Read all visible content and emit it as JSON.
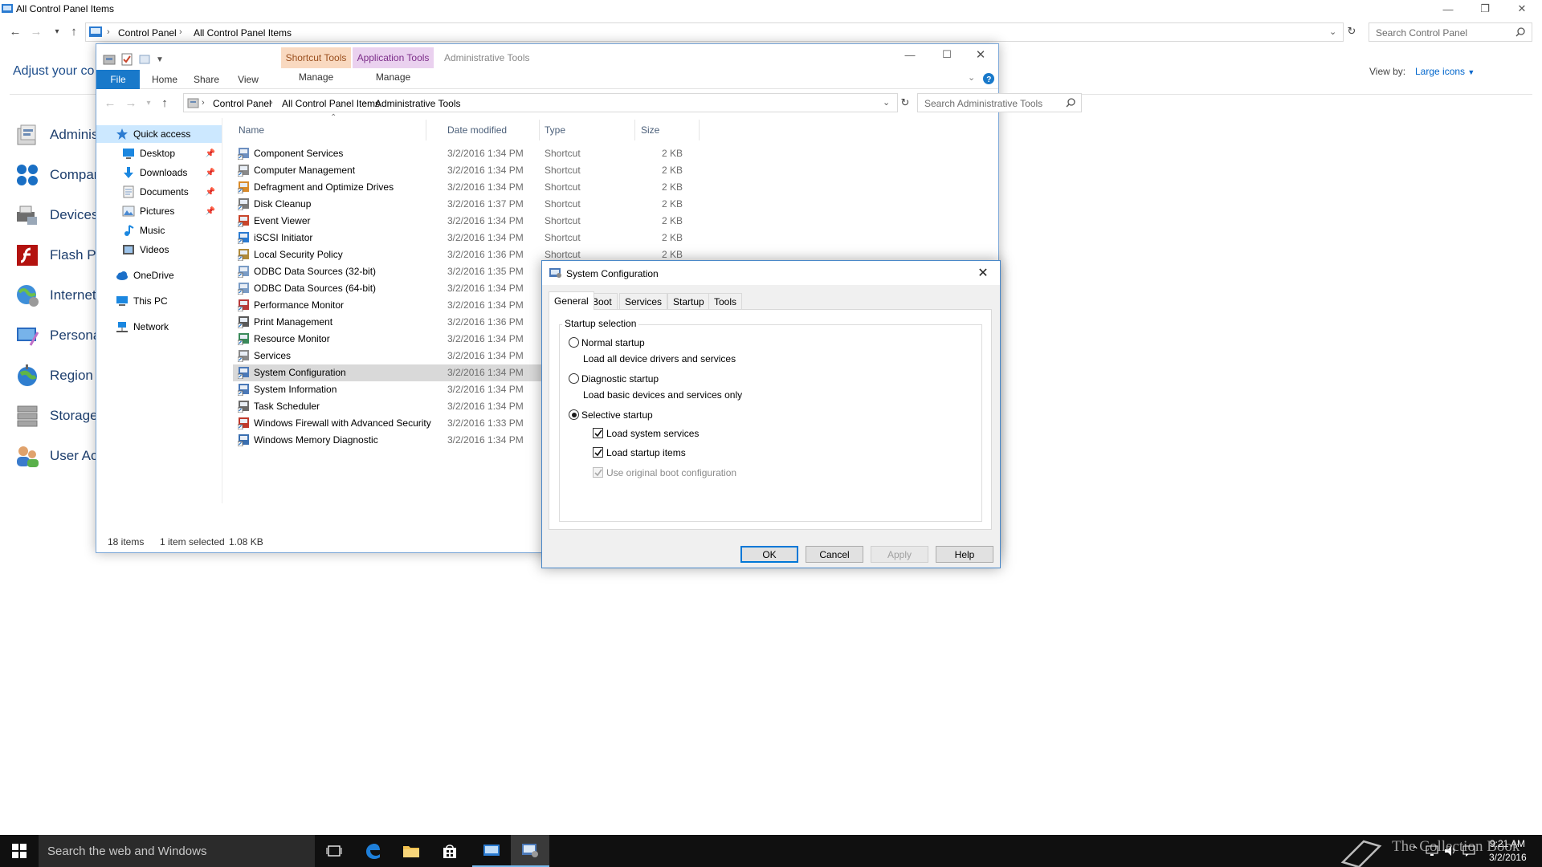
{
  "background_window": {
    "title": "All Control Panel Items",
    "breadcrumb": [
      "Control Panel",
      "All Control Panel Items"
    ],
    "search_placeholder": "Search Control Panel",
    "heading": "Adjust your co",
    "view_by_label": "View by:",
    "view_by_value": "Large icons",
    "items": [
      {
        "label": "Adminis",
        "icon": "administrative-tools-icon"
      },
      {
        "label": "Compan",
        "icon": "companion-icon"
      },
      {
        "label": "Devices",
        "icon": "devices-printers-icon"
      },
      {
        "label": "Flash Pla",
        "icon": "flash-player-icon"
      },
      {
        "label": "Internet",
        "icon": "internet-options-icon"
      },
      {
        "label": "Personal",
        "icon": "personalization-icon"
      },
      {
        "label": "Region",
        "icon": "region-icon"
      },
      {
        "label": "Storage",
        "icon": "storage-spaces-icon"
      },
      {
        "label": "User Acc",
        "icon": "user-accounts-icon"
      }
    ]
  },
  "explorer": {
    "title": "Administrative Tools",
    "ribbon": {
      "file": "File",
      "tabs": [
        "Home",
        "Share",
        "View"
      ],
      "context_tabs": [
        {
          "group": "Shortcut Tools",
          "tab": "Manage",
          "color": "#f9d9c0"
        },
        {
          "group": "Application Tools",
          "tab": "Manage",
          "color": "#ead1ef"
        }
      ]
    },
    "breadcrumb": [
      "Control Panel",
      "All Control Panel Items",
      "Administrative Tools"
    ],
    "search_placeholder": "Search Administrative Tools",
    "nav": {
      "quick_access": "Quick access",
      "pinned": [
        {
          "label": "Desktop",
          "icon": "desktop-icon"
        },
        {
          "label": "Downloads",
          "icon": "downloads-icon"
        },
        {
          "label": "Documents",
          "icon": "documents-icon"
        },
        {
          "label": "Pictures",
          "icon": "pictures-icon"
        }
      ],
      "libraries": [
        {
          "label": "Music",
          "icon": "music-icon"
        },
        {
          "label": "Videos",
          "icon": "videos-icon"
        }
      ],
      "onedrive": "OneDrive",
      "this_pc": "This PC",
      "network": "Network"
    },
    "columns": {
      "name": "Name",
      "date": "Date modified",
      "type": "Type",
      "size": "Size"
    },
    "files": [
      {
        "name": "Component Services",
        "date": "3/2/2016 1:34 PM",
        "type": "Shortcut",
        "size": "2 KB"
      },
      {
        "name": "Computer Management",
        "date": "3/2/2016 1:34 PM",
        "type": "Shortcut",
        "size": "2 KB"
      },
      {
        "name": "Defragment and Optimize Drives",
        "date": "3/2/2016 1:34 PM",
        "type": "Shortcut",
        "size": "2 KB"
      },
      {
        "name": "Disk Cleanup",
        "date": "3/2/2016 1:37 PM",
        "type": "Shortcut",
        "size": "2 KB"
      },
      {
        "name": "Event Viewer",
        "date": "3/2/2016 1:34 PM",
        "type": "Shortcut",
        "size": "2 KB"
      },
      {
        "name": "iSCSI Initiator",
        "date": "3/2/2016 1:34 PM",
        "type": "Shortcut",
        "size": "2 KB"
      },
      {
        "name": "Local Security Policy",
        "date": "3/2/2016 1:36 PM",
        "type": "Shortcut",
        "size": "2 KB"
      },
      {
        "name": "ODBC Data Sources (32-bit)",
        "date": "3/2/2016 1:35 PM",
        "type": "",
        "size": ""
      },
      {
        "name": "ODBC Data Sources (64-bit)",
        "date": "3/2/2016 1:34 PM",
        "type": "",
        "size": ""
      },
      {
        "name": "Performance Monitor",
        "date": "3/2/2016 1:34 PM",
        "type": "",
        "size": ""
      },
      {
        "name": "Print Management",
        "date": "3/2/2016 1:36 PM",
        "type": "",
        "size": ""
      },
      {
        "name": "Resource Monitor",
        "date": "3/2/2016 1:34 PM",
        "type": "",
        "size": ""
      },
      {
        "name": "Services",
        "date": "3/2/2016 1:34 PM",
        "type": "",
        "size": ""
      },
      {
        "name": "System Configuration",
        "date": "3/2/2016 1:34 PM",
        "type": "",
        "size": "",
        "selected": true
      },
      {
        "name": "System Information",
        "date": "3/2/2016 1:34 PM",
        "type": "",
        "size": ""
      },
      {
        "name": "Task Scheduler",
        "date": "3/2/2016 1:34 PM",
        "type": "",
        "size": ""
      },
      {
        "name": "Windows Firewall with Advanced Security",
        "date": "3/2/2016 1:33 PM",
        "type": "",
        "size": ""
      },
      {
        "name": "Windows Memory Diagnostic",
        "date": "3/2/2016 1:34 PM",
        "type": "",
        "size": ""
      }
    ],
    "status": {
      "count": "18 items",
      "selection": "1 item selected",
      "size": "1.08 KB"
    }
  },
  "msconfig": {
    "title": "System Configuration",
    "tabs": [
      "General",
      "Boot",
      "Services",
      "Startup",
      "Tools"
    ],
    "active_tab": "General",
    "group_label": "Startup selection",
    "normal": {
      "label": "Normal startup",
      "desc": "Load all device drivers and services",
      "selected": false
    },
    "diagnostic": {
      "label": "Diagnostic startup",
      "desc": "Load basic devices and services only",
      "selected": false
    },
    "selective": {
      "label": "Selective startup",
      "selected": true
    },
    "load_system_services": {
      "label": "Load system services",
      "checked": true
    },
    "load_startup_items": {
      "label": "Load startup items",
      "checked": true
    },
    "use_original_boot": {
      "label": "Use original boot configuration",
      "checked": true,
      "disabled": true
    },
    "buttons": {
      "ok": "OK",
      "cancel": "Cancel",
      "apply": "Apply",
      "help": "Help"
    }
  },
  "taskbar": {
    "search_placeholder": "Search the web and Windows",
    "apps": [
      "task-view-icon",
      "edge-icon",
      "file-explorer-icon",
      "store-icon",
      "control-panel-icon",
      "system-configuration-icon"
    ],
    "time": "9:21 AM",
    "date": "3/2/2016"
  },
  "watermark": "The Collection Book",
  "colors": {
    "accent": "#0078d7",
    "file_tab": "#1979ca",
    "link": "#0066cc",
    "taskbar": "#101010"
  }
}
